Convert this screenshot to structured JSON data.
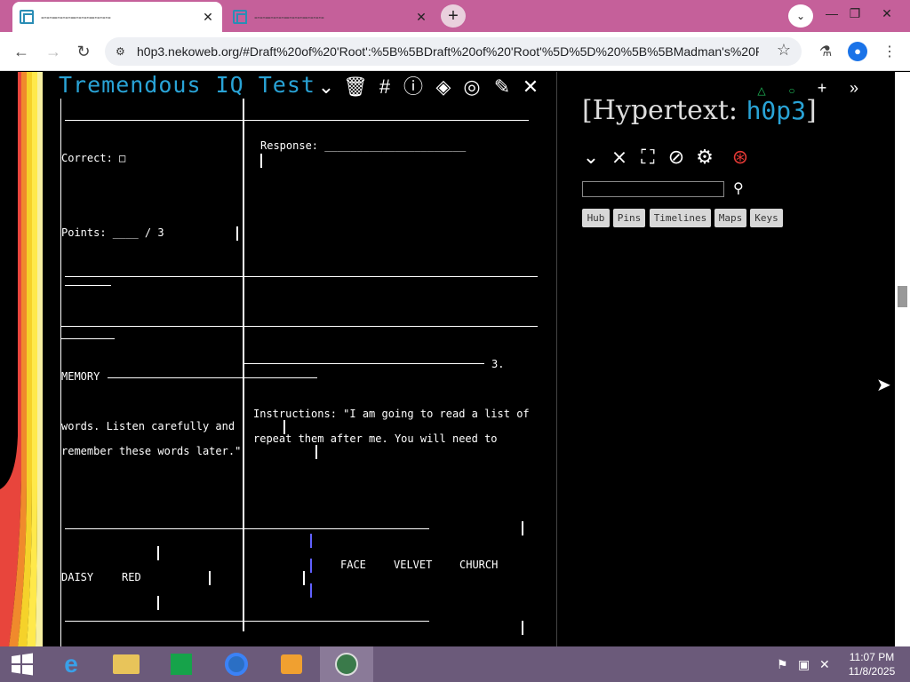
{
  "browser": {
    "tabs": [
      {
        "title": "-·-·--·-·-·--·-·-·--·-·-·-",
        "active": true
      },
      {
        "title": "-·-·--·-·-·--·-·-·--·-·-·-",
        "active": false
      }
    ],
    "url": "h0p3.nekoweb.org/#Draft%20of%20'Root':%5B%5BDraft%20of%20'Root'%5D%5D%20%5B%5BMadman's%20Ph..."
  },
  "left": {
    "title": "Tremendous IQ Test",
    "lines": {
      "correct": "Correct: □",
      "response": "Response: ______________________",
      "points": "Points: ____ / 3",
      "memory": "MEMORY",
      "section_number": "3.",
      "instructions_a": "Instructions: \"I am going to read a list of",
      "instructions_b": "repeat them after me. You will need to",
      "words_a": "words. Listen carefully and",
      "words_b": "remember these words later.\"",
      "face": "FACE",
      "velvet": "VELVET",
      "church": "CHURCH",
      "daisy": "DAISY",
      "red": "RED"
    }
  },
  "right": {
    "title_main": "Hypertext:",
    "title_accent": "h0p3",
    "buttons": [
      "Hub",
      "Pins",
      "Timelines",
      "Maps",
      "Keys"
    ]
  },
  "taskbar": {
    "time": "11:07 PM",
    "date": "11/8/2025"
  }
}
